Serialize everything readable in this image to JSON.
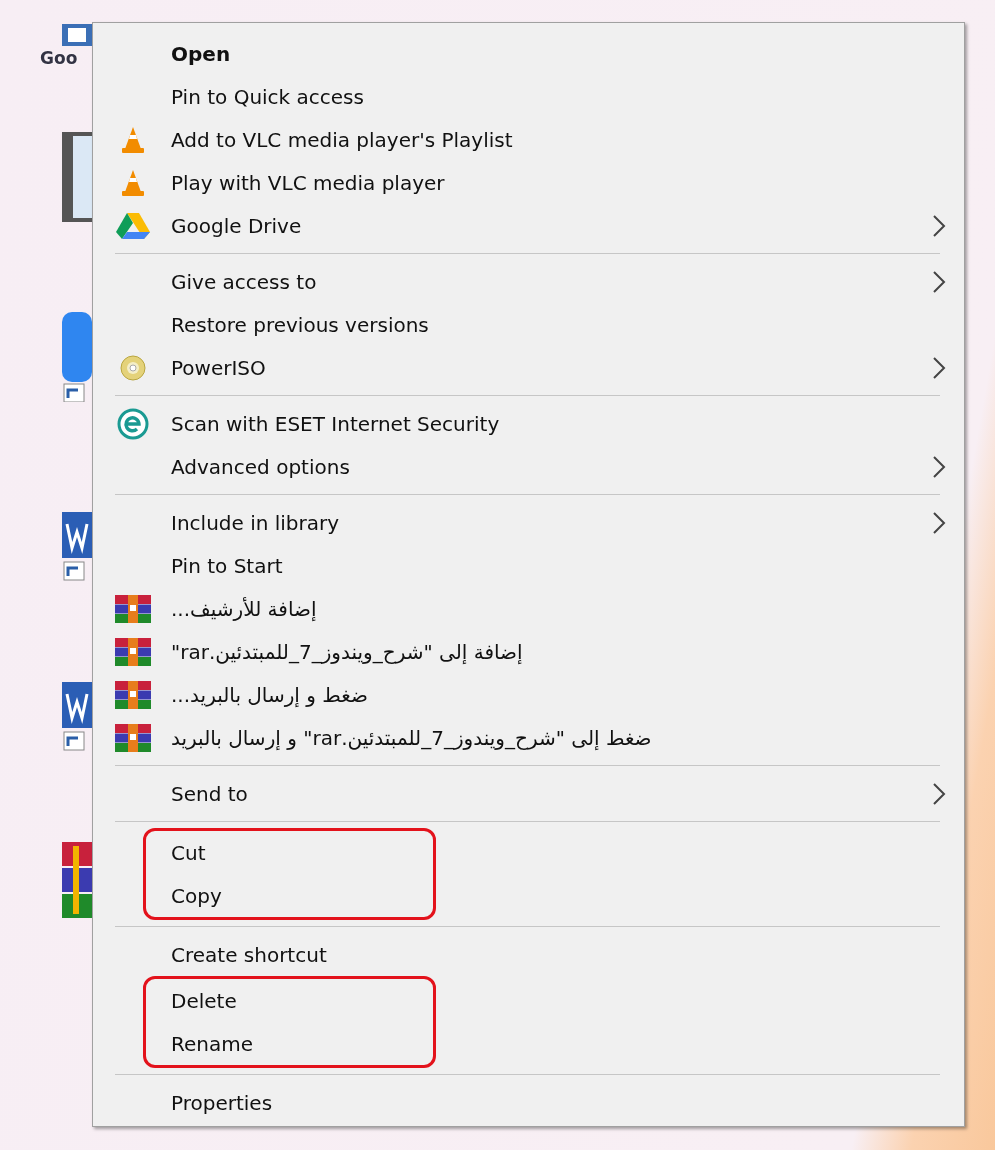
{
  "desktop": {
    "icons": [
      {
        "kind": "generic",
        "label": "Goo"
      },
      {
        "kind": "film"
      },
      {
        "kind": "app"
      },
      {
        "kind": "word"
      },
      {
        "kind": "word"
      },
      {
        "kind": "archive"
      }
    ]
  },
  "context_menu": {
    "sections": [
      {
        "items": [
          {
            "label": "Open",
            "default": true,
            "kind": "plain",
            "submenu": false,
            "highlighted": false
          },
          {
            "label": "Pin to Quick access",
            "default": false,
            "kind": "plain",
            "submenu": false,
            "highlighted": false
          },
          {
            "label": "Add to VLC media player's Playlist",
            "default": false,
            "kind": "cone",
            "submenu": false,
            "highlighted": false
          },
          {
            "label": "Play with VLC media player",
            "default": false,
            "kind": "cone",
            "submenu": false,
            "highlighted": false
          },
          {
            "label": "Google Drive",
            "default": false,
            "kind": "drive",
            "submenu": true,
            "highlighted": false
          }
        ]
      },
      {
        "items": [
          {
            "label": "Give access to",
            "default": false,
            "kind": "plain",
            "submenu": true,
            "highlighted": false
          },
          {
            "label": "Restore previous versions",
            "default": false,
            "kind": "plain",
            "submenu": false,
            "highlighted": false
          },
          {
            "label": "PowerISO",
            "default": false,
            "kind": "disc",
            "submenu": true,
            "highlighted": false
          }
        ]
      },
      {
        "items": [
          {
            "label": "Scan with ESET Internet Security",
            "default": false,
            "kind": "eset",
            "submenu": false,
            "highlighted": false
          },
          {
            "label": "Advanced options",
            "default": false,
            "kind": "plain",
            "submenu": true,
            "highlighted": false
          }
        ]
      },
      {
        "items": [
          {
            "label": "Include in library",
            "default": false,
            "kind": "plain",
            "submenu": true,
            "highlighted": false
          },
          {
            "label": "Pin to Start",
            "default": false,
            "kind": "plain",
            "submenu": false,
            "highlighted": false
          },
          {
            "label": "إضافة للأرشيف...",
            "default": false,
            "kind": "archive",
            "submenu": false,
            "highlighted": false
          },
          {
            "label": "إضافة إلى \"شرح_ويندوز_7_للمبتدئين.rar\"",
            "default": false,
            "kind": "archive",
            "submenu": false,
            "highlighted": false
          },
          {
            "label": "ضغط و إرسال بالبريد...",
            "default": false,
            "kind": "archive",
            "submenu": false,
            "highlighted": false
          },
          {
            "label": "ضغط إلى \"شرح_ويندوز_7_للمبتدئين.rar\" و إرسال بالبريد",
            "default": false,
            "kind": "archive",
            "submenu": false,
            "highlighted": false
          }
        ]
      },
      {
        "items": [
          {
            "label": "Send to",
            "default": false,
            "kind": "plain",
            "submenu": true,
            "highlighted": false
          }
        ]
      },
      {
        "items": [
          {
            "label": "Cut",
            "default": false,
            "kind": "plain",
            "submenu": false,
            "highlighted": true
          },
          {
            "label": "Copy",
            "default": false,
            "kind": "plain",
            "submenu": false,
            "highlighted": true
          }
        ]
      },
      {
        "items": [
          {
            "label": "Create shortcut",
            "default": false,
            "kind": "plain",
            "submenu": false,
            "highlighted": false
          },
          {
            "label": "Delete",
            "default": false,
            "kind": "plain",
            "submenu": false,
            "highlighted": true
          },
          {
            "label": "Rename",
            "default": false,
            "kind": "plain",
            "submenu": false,
            "highlighted": true
          }
        ]
      },
      {
        "items": [
          {
            "label": "Properties",
            "default": false,
            "kind": "plain",
            "submenu": false,
            "highlighted": false
          }
        ]
      }
    ]
  }
}
